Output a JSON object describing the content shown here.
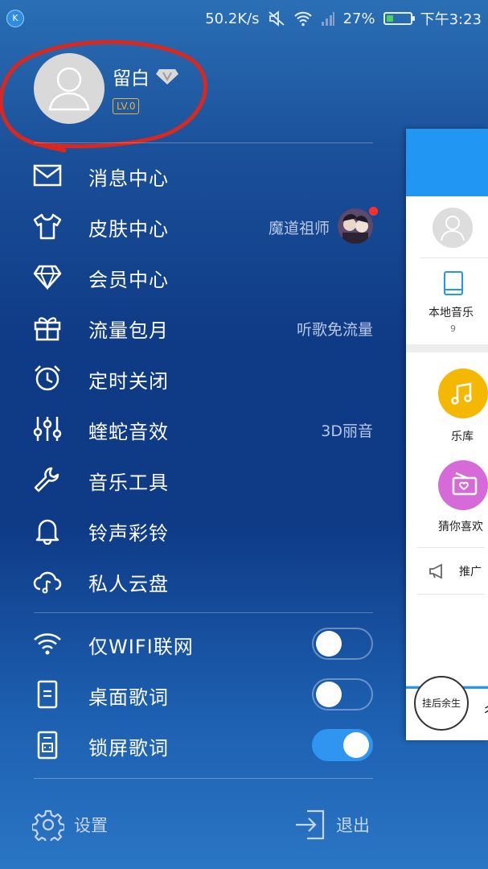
{
  "status_bar": {
    "app_badge": "K",
    "network_speed": "50.2K/s",
    "battery_percent": "27%",
    "battery_level": 0.27,
    "time": "下午3:23"
  },
  "profile": {
    "username": "留白",
    "level": "LV.0"
  },
  "menu": {
    "items": [
      {
        "label": "消息中心",
        "icon": "mail-icon"
      },
      {
        "label": "皮肤中心",
        "icon": "shirt-icon",
        "extra": "魔道祖师"
      },
      {
        "label": "会员中心",
        "icon": "diamond-icon"
      },
      {
        "label": "流量包月",
        "icon": "gift-icon",
        "extra": "听歌免流量"
      },
      {
        "label": "定时关闭",
        "icon": "alarm-clock-icon"
      },
      {
        "label": "蝰蛇音效",
        "icon": "equalizer-icon",
        "extra": "3D丽音"
      },
      {
        "label": "音乐工具",
        "icon": "wrench-icon"
      },
      {
        "label": "铃声彩铃",
        "icon": "bell-icon"
      },
      {
        "label": "私人云盘",
        "icon": "cloud-music-icon"
      }
    ],
    "toggles": [
      {
        "label": "仅WIFI联网",
        "icon": "wifi-icon",
        "on": false
      },
      {
        "label": "桌面歌词",
        "icon": "phone-lyrics-icon",
        "on": false
      },
      {
        "label": "锁屏歌词",
        "icon": "lockscreen-lyrics-icon",
        "on": true
      }
    ]
  },
  "bottom": {
    "settings_label": "设置",
    "logout_label": "退出"
  },
  "preview": {
    "local_music_label": "本地音乐",
    "local_music_count": "9",
    "library_label": "乐库",
    "guess_label": "猜你喜欢",
    "ad_label": "推广",
    "disc_text": "挂后余生"
  },
  "colors": {
    "accent_blue": "#2f95f0",
    "level_gold": "#e8b33a",
    "notification_red": "#ff2d2d",
    "annotation_red": "#d9281f"
  }
}
